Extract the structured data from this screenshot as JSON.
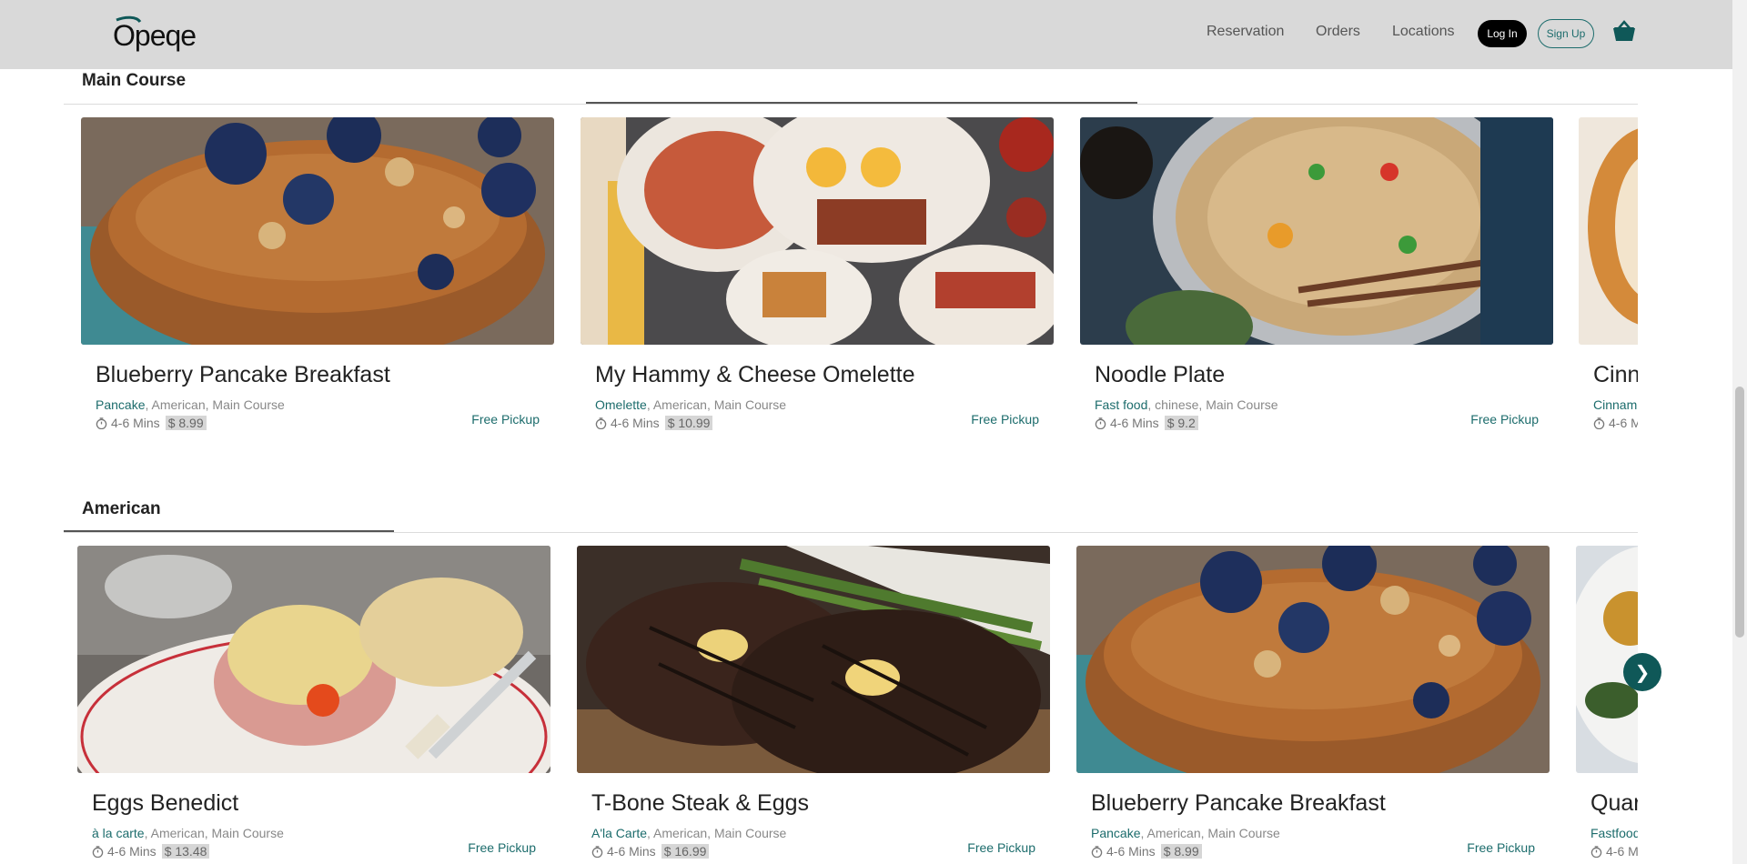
{
  "header": {
    "logo_text": "Opeqe",
    "nav": [
      "Reservation",
      "Orders",
      "Locations"
    ],
    "login_label": "Log In",
    "signup_label": "Sign Up"
  },
  "sections": [
    {
      "title": "Main Course",
      "cards": [
        {
          "title": "Blueberry Pancake Breakfast",
          "tag_primary": "Pancake",
          "tags_rest": ", American, Main Course",
          "time": "4-6 Mins",
          "price": "$ 8.99",
          "pickup": "Free Pickup"
        },
        {
          "title": "My Hammy & Cheese Omelette",
          "tag_primary": "Omelette",
          "tags_rest": ", American, Main Course",
          "time": "4-6 Mins",
          "price": "$ 10.99",
          "pickup": "Free Pickup"
        },
        {
          "title": "Noodle Plate",
          "tag_primary": "Fast food",
          "tags_rest": ", chinese, Main Course",
          "time": "4-6 Mins",
          "price": "$ 9.2",
          "pickup": "Free Pickup"
        },
        {
          "title": "Cinn",
          "tag_primary": "Cinnam",
          "tags_rest": "",
          "time": "4-6 M",
          "price": "",
          "pickup": ""
        }
      ]
    },
    {
      "title": "American",
      "cards": [
        {
          "title": "Eggs Benedict",
          "tag_primary": "à la carte",
          "tags_rest": ", American, Main Course",
          "time": "4-6 Mins",
          "price": "$ 13.48",
          "pickup": "Free Pickup"
        },
        {
          "title": "T-Bone Steak & Eggs",
          "tag_primary": "A'la Carte",
          "tags_rest": ", American, Main Course",
          "time": "4-6 Mins",
          "price": "$ 16.99",
          "pickup": "Free Pickup"
        },
        {
          "title": "Blueberry Pancake Breakfast",
          "tag_primary": "Pancake",
          "tags_rest": ", American, Main Course",
          "time": "4-6 Mins",
          "price": "$ 8.99",
          "pickup": "Free Pickup"
        },
        {
          "title": "Quar",
          "tag_primary": "Fastfood",
          "tags_rest": "",
          "time": "4-6 M",
          "price": "",
          "pickup": ""
        }
      ]
    }
  ],
  "next_arrow": "❯",
  "colors": {
    "header_bg": "#d9d9d9",
    "accent": "#1c6c6c",
    "next_btn": "#0f5858"
  }
}
